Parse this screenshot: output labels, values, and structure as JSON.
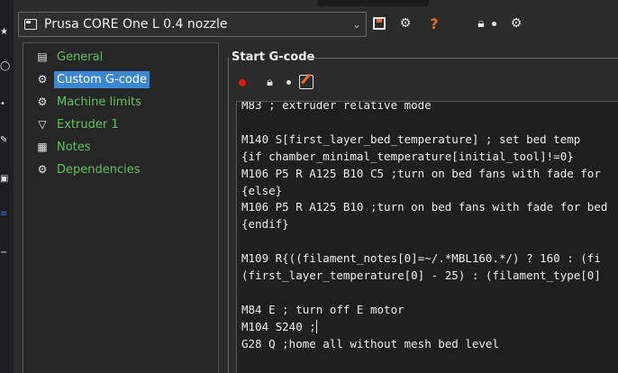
{
  "preset": {
    "name": "Prusa CORE One L 0.4 nozzle",
    "icon": "printer-preset-icon"
  },
  "header_icons": [
    "save-icon",
    "gear-icon",
    "question-icon",
    "lock-icon",
    "dependency-icon"
  ],
  "header_help": "?",
  "colors": {
    "accent_orange": "#ed6b21",
    "tree_green": "#5fc35f",
    "selection_blue": "#3d86d1",
    "modified_red": "#e01818"
  },
  "tree": {
    "items": [
      {
        "label": "General",
        "icon": "printer-icon"
      },
      {
        "label": "Custom G-code",
        "icon": "gear-icon",
        "selected": true
      },
      {
        "label": "Machine limits",
        "icon": "gear-icon"
      },
      {
        "label": "Extruder 1",
        "icon": "extruder-icon"
      },
      {
        "label": "Notes",
        "icon": "notes-icon"
      },
      {
        "label": "Dependencies",
        "icon": "dependencies-icon"
      }
    ]
  },
  "section": {
    "title": "Start G-code"
  },
  "editor": {
    "lines": [
      "M83 ; extruder relative mode",
      "",
      "M140 S[first_layer_bed_temperature] ; set bed temp",
      "{if chamber_minimal_temperature[initial_tool]!=0}",
      "M106 P5 R A125 B10 C5 ;turn on bed fans with fade for",
      "{else}",
      "M106 P5 R A125 B10 ;turn on bed fans with fade for bed",
      "{endif}",
      "",
      "M109 R{((filament_notes[0]=~/.*MBL160.*/) ? 160 : (fi",
      "(first_layer_temperature[0] - 25) : (filament_type[0]",
      "",
      "M84 E ; turn off E motor",
      "M104 S240 ;",
      "G28 Q ;home all without mesh bed level"
    ]
  }
}
